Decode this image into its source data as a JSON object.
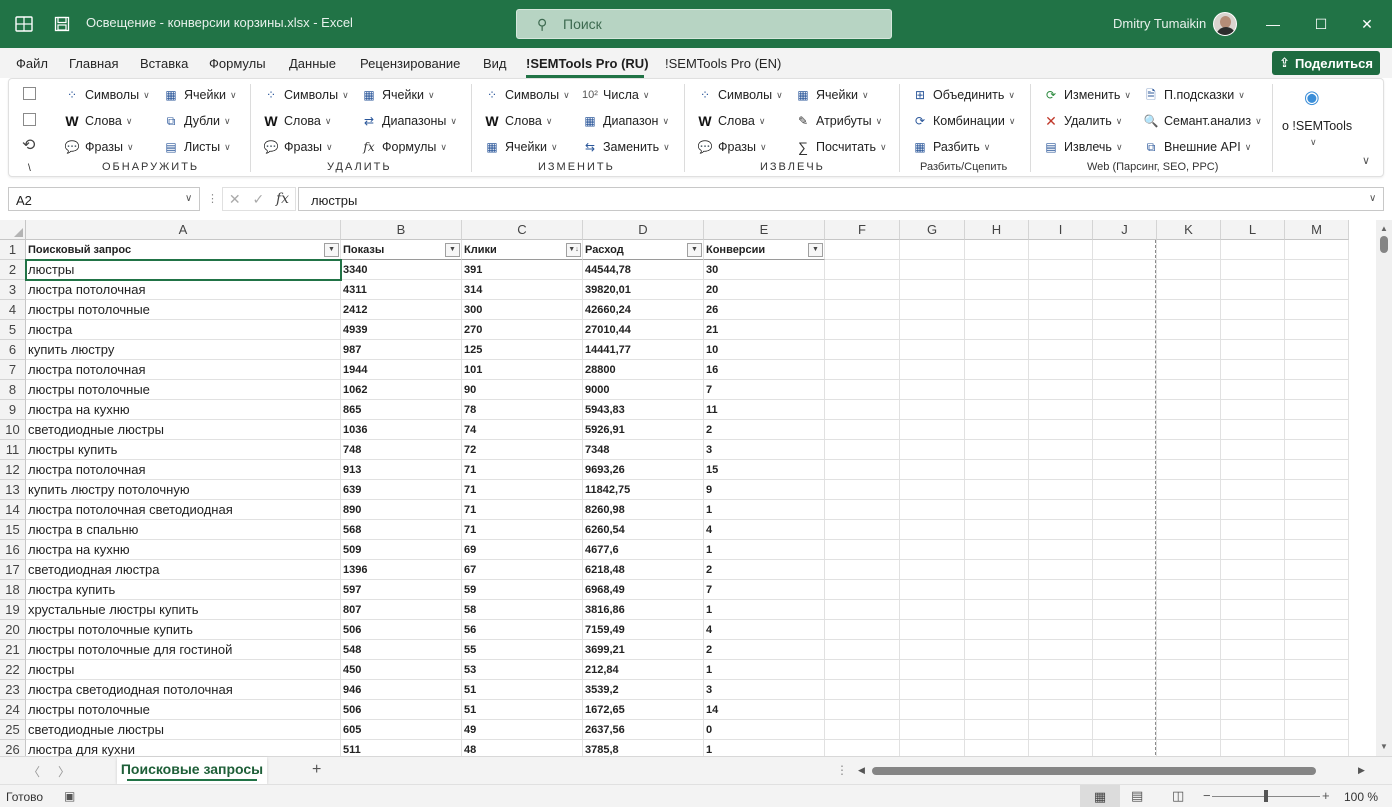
{
  "window": {
    "title": "Освещение - конверсии корзины.xlsx  -  Excel",
    "search_placeholder": "Поиск",
    "user_name": "Dmitry Tumaikin"
  },
  "menu": {
    "tabs": [
      "Файл",
      "Главная",
      "Вставка",
      "Формулы",
      "Данные",
      "Рецензирование",
      "Вид",
      "!SEMTools Pro (RU)",
      "!SEMTools Pro (EN)"
    ],
    "active_tab": "!SEMTools Pro (RU)",
    "share_label": "Поделиться"
  },
  "ribbon": {
    "detect": {
      "symbols": "Символы",
      "words": "Слова",
      "phrases": "Фразы",
      "cells": "Ячейки",
      "duplicates": "Дубли",
      "sheets": "Листы",
      "label": "ОБНАРУЖИТЬ",
      "misc": "\\"
    },
    "remove": {
      "symbols": "Символы",
      "words": "Слова",
      "phrases": "Фразы",
      "cells": "Ячейки",
      "ranges": "Диапазоны",
      "formulas": "Формулы",
      "label": "УДАЛИТЬ"
    },
    "change": {
      "symbols": "Символы",
      "words": "Слова",
      "cells": "Ячейки",
      "numbers": "Числа",
      "range": "Диапазон",
      "replace": "Заменить",
      "label": "ИЗМЕНИТЬ"
    },
    "extract": {
      "symbols": "Символы",
      "words": "Слова",
      "phrases": "Фразы",
      "cells": "Ячейки",
      "attributes": "Атрибуты",
      "count": "Посчитать",
      "label": "ИЗВЛЕЧЬ"
    },
    "split": {
      "merge": "Объединить",
      "combinations": "Комбинации",
      "split": "Разбить",
      "label": "Разбить/Сцепить"
    },
    "web": {
      "change": "Изменить",
      "delete": "Удалить",
      "extract": "Извлечь",
      "hints": "П.подсказки",
      "semantic": "Семант.анализ",
      "external_api": "Внешние API",
      "label": "Web (Парсинг, SEO, PPC)"
    },
    "about": "о !SEMTools"
  },
  "formula_bar": {
    "name_box": "A2",
    "formula": "люстры"
  },
  "sheet": {
    "columns": [
      "A",
      "B",
      "C",
      "D",
      "E",
      "F",
      "G",
      "H",
      "I",
      "J",
      "K",
      "L",
      "M"
    ],
    "headers": [
      "Поисковый запрос",
      "Показы",
      "Клики",
      "Расход",
      "Конверсии"
    ],
    "rows": [
      [
        "люстры",
        "3340",
        "391",
        "44544,78",
        "30"
      ],
      [
        "люстра потолочная",
        "4311",
        "314",
        "39820,01",
        "20"
      ],
      [
        "люстры потолочные",
        "2412",
        "300",
        "42660,24",
        "26"
      ],
      [
        "люстра",
        "4939",
        "270",
        "27010,44",
        "21"
      ],
      [
        "купить люстру",
        "987",
        "125",
        "14441,77",
        "10"
      ],
      [
        "люстра потолочная",
        "1944",
        "101",
        "28800",
        "16"
      ],
      [
        "люстры потолочные",
        "1062",
        "90",
        "9000",
        "7"
      ],
      [
        "люстра на кухню",
        "865",
        "78",
        "5943,83",
        "11"
      ],
      [
        "светодиодные люстры",
        "1036",
        "74",
        "5926,91",
        "2"
      ],
      [
        "люстры купить",
        "748",
        "72",
        "7348",
        "3"
      ],
      [
        "люстра потолочная",
        "913",
        "71",
        "9693,26",
        "15"
      ],
      [
        "купить люстру потолочную",
        "639",
        "71",
        "11842,75",
        "9"
      ],
      [
        "люстра потолочная светодиодная",
        "890",
        "71",
        "8260,98",
        "1"
      ],
      [
        "люстра в спальню",
        "568",
        "71",
        "6260,54",
        "4"
      ],
      [
        "люстра на кухню",
        "509",
        "69",
        "4677,6",
        "1"
      ],
      [
        "светодиодная люстра",
        "1396",
        "67",
        "6218,48",
        "2"
      ],
      [
        "люстра купить",
        "597",
        "59",
        "6968,49",
        "7"
      ],
      [
        "хрустальные люстры купить",
        "807",
        "58",
        "3816,86",
        "1"
      ],
      [
        "люстры потолочные купить",
        "506",
        "56",
        "7159,49",
        "4"
      ],
      [
        "люстры потолочные для гостиной",
        "548",
        "55",
        "3699,21",
        "2"
      ],
      [
        "люстры",
        "450",
        "53",
        "212,84",
        "1"
      ],
      [
        "люстра светодиодная потолочная",
        "946",
        "51",
        "3539,2",
        "3"
      ],
      [
        "люстры потолочные",
        "506",
        "51",
        "1672,65",
        "14"
      ],
      [
        "светодиодные люстры",
        "605",
        "49",
        "2637,56",
        "0"
      ],
      [
        "люстра для кухни",
        "511",
        "48",
        "3785,8",
        "1"
      ]
    ]
  },
  "tabs": {
    "sheet_name": "Поисковые запросы"
  },
  "status": {
    "ready": "Готово",
    "zoom": "100 %"
  }
}
